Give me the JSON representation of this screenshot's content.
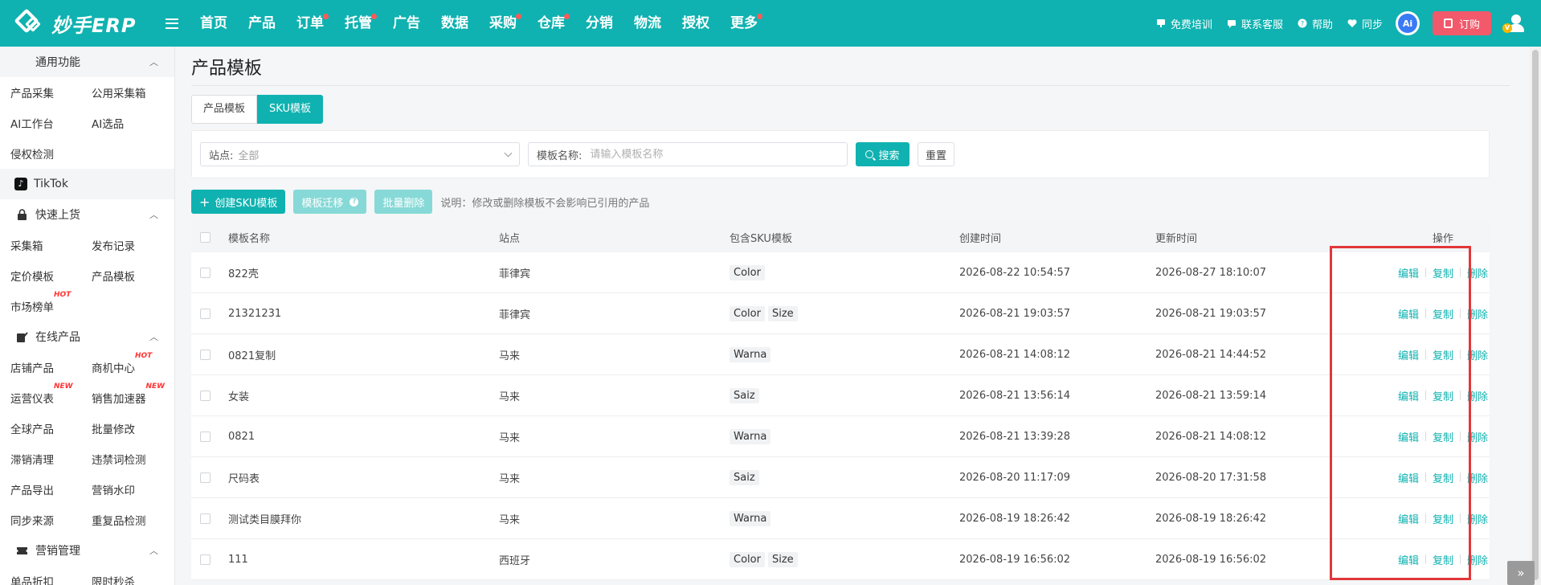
{
  "app": {
    "logo_text": "妙手ERP"
  },
  "nav": [
    {
      "label": "首页",
      "dot": false
    },
    {
      "label": "产品",
      "dot": false
    },
    {
      "label": "订单",
      "dot": true
    },
    {
      "label": "托管",
      "dot": true
    },
    {
      "label": "广告",
      "dot": false
    },
    {
      "label": "数据",
      "dot": false
    },
    {
      "label": "采购",
      "dot": true
    },
    {
      "label": "仓库",
      "dot": true
    },
    {
      "label": "分销",
      "dot": false
    },
    {
      "label": "物流",
      "dot": false
    },
    {
      "label": "授权",
      "dot": false
    },
    {
      "label": "更多",
      "dot": true
    }
  ],
  "top_right": {
    "training": "免费培训",
    "support": "联系客服",
    "help": "帮助",
    "sync": "同步",
    "ai": "Ai",
    "order": "订购",
    "vip": "V"
  },
  "sidebar": {
    "general": {
      "title": "通用功能",
      "rows": [
        [
          "产品采集",
          "公用采集箱"
        ],
        [
          "AI工作台",
          "AI选品"
        ],
        [
          "侵权检测",
          ""
        ]
      ]
    },
    "tiktok": "TikTok",
    "quick_upload": {
      "title": "快速上货",
      "rows": [
        [
          "采集箱",
          "发布记录"
        ],
        [
          "定价模板",
          "产品模板"
        ],
        [
          "市场榜单",
          ""
        ]
      ],
      "hot_badge": "HOT"
    },
    "online": {
      "title": "在线产品",
      "rows": [
        [
          "店铺产品",
          "商机中心"
        ],
        [
          "运营仪表",
          "销售加速器"
        ],
        [
          "全球产品",
          "批量修改"
        ],
        [
          "滞销清理",
          "违禁词检测"
        ],
        [
          "产品导出",
          "营销水印"
        ],
        [
          "同步来源",
          "重复品检测"
        ]
      ],
      "hot_badge": "HOT",
      "new_badge": "NEW"
    },
    "marketing": {
      "title": "营销管理",
      "rows": [
        [
          "单品折扣",
          "限时秒杀"
        ]
      ]
    }
  },
  "page": {
    "title": "产品模板",
    "tabs": [
      "产品模板",
      "SKU模板"
    ],
    "filter": {
      "site_label": "站点:",
      "site_value": "全部",
      "name_label": "模板名称:",
      "name_placeholder": "请输入模板名称",
      "search": "搜索",
      "reset": "重置"
    },
    "actions": {
      "create": "创建SKU模板",
      "migrate": "模板迁移",
      "batch_delete": "批量删除",
      "note": "说明：修改或删除模板不会影响已引用的产品"
    },
    "table": {
      "headers": {
        "name": "模板名称",
        "site": "站点",
        "sku": "包含SKU模板",
        "created": "创建时间",
        "updated": "更新时间",
        "ops": "操作"
      },
      "op_labels": {
        "edit": "编辑",
        "copy": "复制",
        "delete": "删除"
      },
      "rows": [
        {
          "name": "822壳",
          "site": "菲律宾",
          "skus": [
            "Color"
          ],
          "created": "2026-08-22 10:54:57",
          "updated": "2026-08-27 18:10:07"
        },
        {
          "name": "21321231",
          "site": "菲律宾",
          "skus": [
            "Color",
            "Size"
          ],
          "created": "2026-08-21 19:03:57",
          "updated": "2026-08-21 19:03:57"
        },
        {
          "name": "0821复制",
          "site": "马来",
          "skus": [
            "Warna"
          ],
          "created": "2026-08-21 14:08:12",
          "updated": "2026-08-21 14:44:52"
        },
        {
          "name": "女装",
          "site": "马来",
          "skus": [
            "Saiz"
          ],
          "created": "2026-08-21 13:56:14",
          "updated": "2026-08-21 13:59:14"
        },
        {
          "name": "0821",
          "site": "马来",
          "skus": [
            "Warna"
          ],
          "created": "2026-08-21 13:39:28",
          "updated": "2026-08-21 14:08:12"
        },
        {
          "name": "尺码表",
          "site": "马来",
          "skus": [
            "Saiz"
          ],
          "created": "2026-08-20 11:17:09",
          "updated": "2026-08-20 17:31:58"
        },
        {
          "name": "测试类目膜拜你",
          "site": "马来",
          "skus": [
            "Warna"
          ],
          "created": "2026-08-19 18:26:42",
          "updated": "2026-08-19 18:26:42"
        },
        {
          "name": "111",
          "site": "西班牙",
          "skus": [
            "Color",
            "Size"
          ],
          "created": "2026-08-19 16:56:02",
          "updated": "2026-08-19 16:56:02"
        }
      ]
    }
  },
  "colors": {
    "primary": "#0fb2b0",
    "highlight_box": "#e0373b",
    "order": "#f2596b"
  }
}
